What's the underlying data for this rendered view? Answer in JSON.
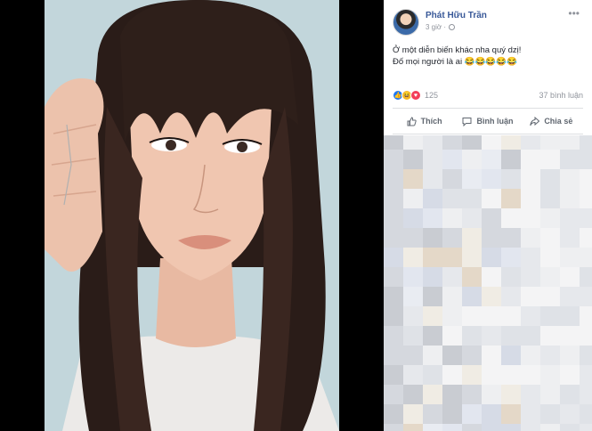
{
  "post": {
    "author": "Phát Hữu Trần",
    "time": "3 giờ ·",
    "lines": [
      "Ở một diễn biến khác nha quý dzị!",
      "Đố mọi người là ai 😂😂😂😂😂"
    ],
    "reaction_count": "125",
    "comment_count": "37 bình luận"
  },
  "actions": {
    "like": "Thích",
    "comment": "Bình luận",
    "share": "Chia sẻ"
  },
  "icons": {
    "more": "more-options-icon",
    "globe": "globe-icon",
    "like": "thumbs-up-icon",
    "comment": "speech-bubble-icon",
    "share": "share-arrow-icon"
  },
  "colors": {
    "author": "#385898",
    "like_reaction": "#2078f4",
    "haha_reaction": "#f7b928",
    "love_reaction": "#f33e58"
  }
}
